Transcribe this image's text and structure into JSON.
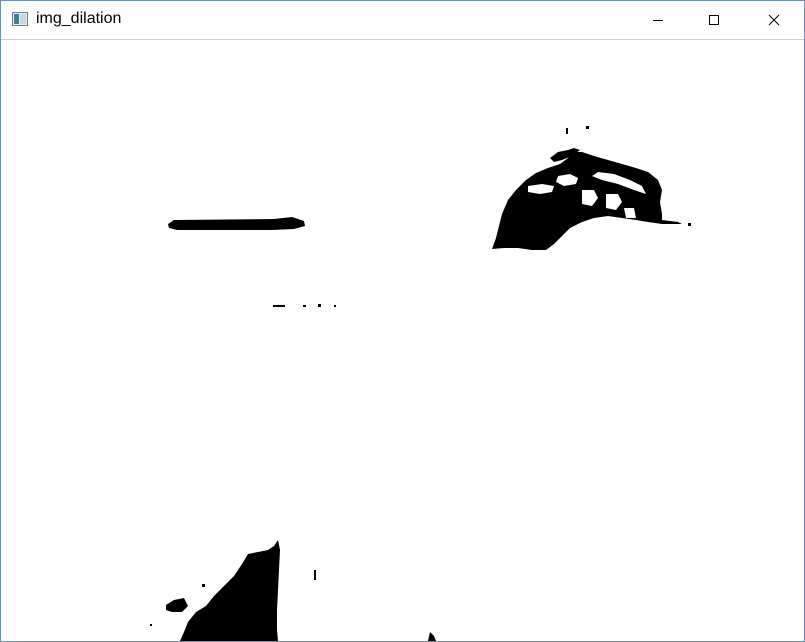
{
  "window": {
    "title": "img_dilation",
    "controls": {
      "minimize_icon": "minimize-icon",
      "maximize_icon": "maximize-icon",
      "close_icon": "close-icon"
    }
  },
  "image": {
    "description_colors": {
      "foreground": "#000000",
      "background": "#ffffff"
    }
  }
}
